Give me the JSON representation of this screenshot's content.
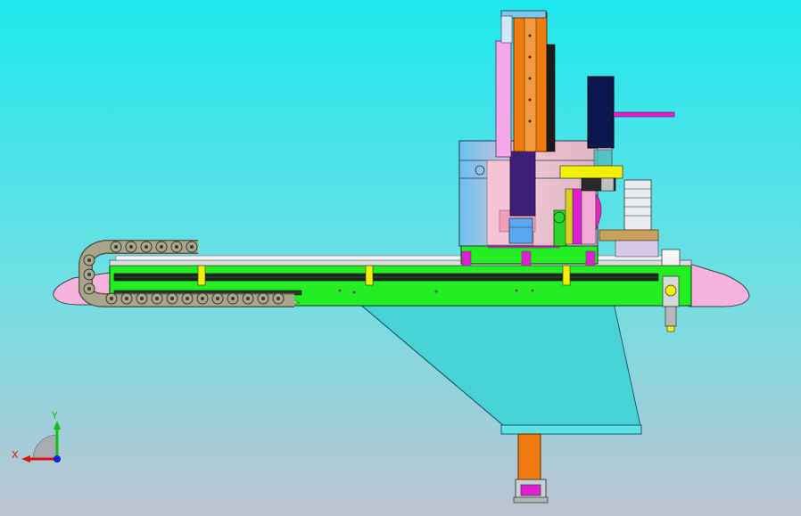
{
  "viewport": {
    "background_top": "#1ee8ef",
    "background_bottom": "#bcc3d0"
  },
  "triad": {
    "x_label": "X",
    "y_label": "Y",
    "x_color": "#e01010",
    "y_color": "#10c010",
    "z_color": "#1020e0"
  },
  "colors": {
    "green_plate": "#22ee22",
    "pink_end": "#f3b3dc",
    "cyan_bracket": "#4ad3d6",
    "orange_column": "#ee7a10",
    "chain": "#a9a58c",
    "light_blue_body": "#7cc7ee",
    "magenta": "#e020d0",
    "navy_motor": "#0b1850",
    "yellow_detail": "#f0f000"
  }
}
